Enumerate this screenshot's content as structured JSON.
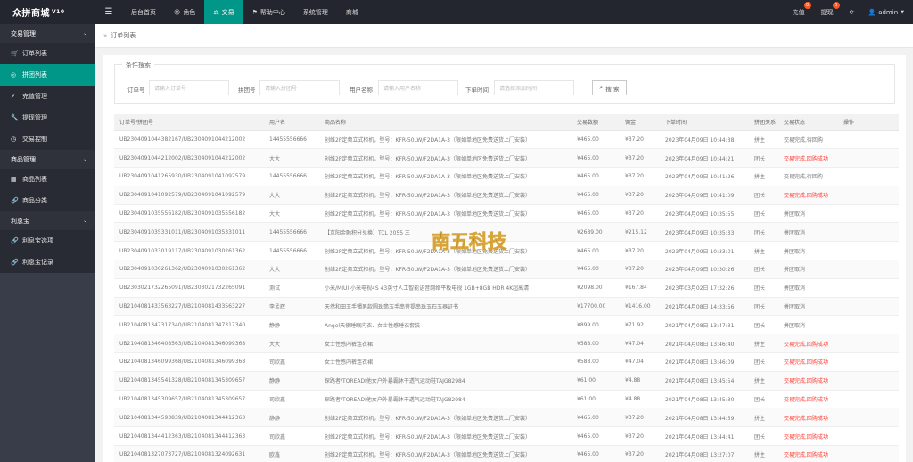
{
  "app": {
    "logo_text": "众拼商城",
    "logo_version": "V10"
  },
  "topnav": {
    "items": [
      {
        "label": "后台首页",
        "icon": ""
      },
      {
        "label": "角色",
        "icon": "user-icon"
      },
      {
        "label": "交易",
        "icon": "scale-icon"
      },
      {
        "label": "帮助中心",
        "icon": "flag-icon"
      },
      {
        "label": "系统管理",
        "icon": ""
      },
      {
        "label": "商城",
        "icon": ""
      }
    ],
    "active_index": 2
  },
  "topright": {
    "recharge_label": "充值",
    "recharge_badge": "0",
    "withdraw_label": "提现",
    "withdraw_badge": "0",
    "user_label": "admin"
  },
  "sidebar": {
    "groups": [
      {
        "label": "交易管理",
        "items": [
          "订单列表",
          "拼团列表",
          "充值管理",
          "提现管理",
          "交易控制"
        ]
      },
      {
        "label": "商品管理",
        "items": [
          "商品列表",
          "商品分类"
        ]
      },
      {
        "label": "利息宝",
        "items": [
          "利息宝选项",
          "利息宝记录"
        ]
      }
    ],
    "active_item": "拼团列表"
  },
  "breadcrumb": {
    "text": "订单列表"
  },
  "search": {
    "legend": "条件搜索",
    "order_label": "订单号",
    "order_placeholder": "请输入订单号",
    "group_label": "拼团号",
    "group_placeholder": "请输入拼团号",
    "user_label": "用户名称",
    "user_placeholder": "请输入用户名称",
    "time_label": "下单时间",
    "time_placeholder": "请选择添加时间",
    "button_label": "搜 索"
  },
  "table": {
    "headers": [
      "订单号/拼团号",
      "用户名",
      "商品名称",
      "交易数额",
      "佣金",
      "下单时间",
      "拼团关系",
      "交易状态",
      "操作"
    ],
    "rows": [
      {
        "order": "UB2304091044382167/UB2304091044212002",
        "user": "14455556666",
        "product": "创维2P定频立式柜机，型号：KFR-50LW/F2DA1A-3（限如单地区免费送货上门安装）",
        "amount": "¥465.00",
        "commission": "¥37.20",
        "time": "2023年04月09日 10:44:38",
        "relation": "拼主",
        "status": "交易完成,待回购",
        "status_red": false
      },
      {
        "order": "UB2304091044212002/UB2304091044212002",
        "user": "大大",
        "product": "创维2P定频立式柜机，型号：KFR-50LW/F2DA1A-3（限如单地区免费送货上门安装）",
        "amount": "¥465.00",
        "commission": "¥37.20",
        "time": "2023年04月09日 10:44:21",
        "relation": "团长",
        "status": "交易完成,回购成功",
        "status_red": true
      },
      {
        "order": "UB2304091041265930/UB2304091041092579",
        "user": "14455556666",
        "product": "创维2P定频立式柜机，型号：KFR-50LW/F2DA1A-3（限如单地区免费送货上门安装）",
        "amount": "¥465.00",
        "commission": "¥37.20",
        "time": "2023年04月09日 10:41:26",
        "relation": "拼主",
        "status": "交易完成,待回购",
        "status_red": false
      },
      {
        "order": "UB2304091041092579/UB2304091041092579",
        "user": "大大",
        "product": "创维2P定频立式柜机，型号：KFR-50LW/F2DA1A-3（限如单地区免费送货上门安装）",
        "amount": "¥465.00",
        "commission": "¥37.20",
        "time": "2023年04月09日 10:41:09",
        "relation": "团长",
        "status": "交易完成,回购成功",
        "status_red": true
      },
      {
        "order": "UB2304091035556182/UB2304091035556182",
        "user": "大大",
        "product": "创维2P定频立式柜机，型号：KFR-50LW/F2DA1A-3（限如单地区免费送货上门安装）",
        "amount": "¥465.00",
        "commission": "¥37.20",
        "time": "2023年04月09日 10:35:55",
        "relation": "团长",
        "status": "拼团取消",
        "status_red": false
      },
      {
        "order": "UB2304091035331011/UB2304091035331011",
        "user": "14455556666",
        "product": "【京阳金融积分兑换】TCL 2055 三",
        "amount": "¥2689.00",
        "commission": "¥215.12",
        "time": "2023年04月09日 10:35:33",
        "relation": "团长",
        "status": "拼团取消",
        "status_red": false
      },
      {
        "order": "UB2304091033019117/UB2304091030261362",
        "user": "14455556666",
        "product": "创维2P定频立式柜机，型号：KFR-50LW/F2DA1A-3（限如单地区免费送货上门安装）",
        "amount": "¥465.00",
        "commission": "¥37.20",
        "time": "2023年04月09日 10:33:01",
        "relation": "拼主",
        "status": "拼团取消",
        "status_red": false
      },
      {
        "order": "UB2304091030261362/UB2304091030261362",
        "user": "大大",
        "product": "创维2P定频立式柜机，型号：KFR-50LW/F2DA1A-3（限如单地区免费送货上门安装）",
        "amount": "¥465.00",
        "commission": "¥37.20",
        "time": "2023年04月09日 10:30:26",
        "relation": "团长",
        "status": "拼团取消",
        "status_red": false
      },
      {
        "order": "UB2303021732265091/UB2303021732265091",
        "user": "测试",
        "product": "小米/MIUI 小米电视4S 43英寸人工智能语音网络平板电视 1GB+8GB HDR 4K超高清",
        "amount": "¥2098.00",
        "commission": "¥167.84",
        "time": "2023年03月02日 17:32:26",
        "relation": "团长",
        "status": "拼团取消",
        "status_red": false
      },
      {
        "order": "UB2104081433563227/UB2104081433563227",
        "user": "李孟辉",
        "product": "天然和田玉手镯男款圆珠翡玉手串菩提串珠玉石玉器证书",
        "amount": "¥17700.00",
        "commission": "¥1416.00",
        "time": "2021年04月08日 14:33:56",
        "relation": "团长",
        "status": "拼团取消",
        "status_red": false
      },
      {
        "order": "UB2104081347317340/UB2104081347317340",
        "user": "静静",
        "product": "Angel天使睡眠内衣、女士性感睡衣套装",
        "amount": "¥899.00",
        "commission": "¥71.92",
        "time": "2021年04月08日 13:47:31",
        "relation": "团长",
        "status": "拼团取消",
        "status_red": false
      },
      {
        "order": "UB2104081346408563/UB2104081346099368",
        "user": "大大",
        "product": "女士性感内裤连衣裙",
        "amount": "¥588.00",
        "commission": "¥47.04",
        "time": "2021年04月08日 13:46:40",
        "relation": "拼主",
        "status": "交易完成,回购成功",
        "status_red": true
      },
      {
        "order": "UB2104081346099368/UB2104081346099368",
        "user": "司欣鑫",
        "product": "女士性感内裤连衣裙",
        "amount": "¥588.00",
        "commission": "¥47.04",
        "time": "2021年04月08日 13:46:09",
        "relation": "团长",
        "status": "交易完成,回购成功",
        "status_red": true
      },
      {
        "order": "UB2104081345541328/UB2104081345309657",
        "user": "静静",
        "product": "探路者/TOREADI他女户外暴霸休干透气运动鞋TAJG82984",
        "amount": "¥61.00",
        "commission": "¥4.88",
        "time": "2021年04月08日 13:45:54",
        "relation": "拼主",
        "status": "交易完成,回购成功",
        "status_red": true
      },
      {
        "order": "UB2104081345309657/UB2104081345309657",
        "user": "司欣鑫",
        "product": "探路者/TOREADI他女户外暴霸休干透气运动鞋TAJG82984",
        "amount": "¥61.00",
        "commission": "¥4.88",
        "time": "2021年04月08日 13:45:30",
        "relation": "团长",
        "status": "交易完成,回购成功",
        "status_red": true
      },
      {
        "order": "UB2104081344593839/UB2104081344412363",
        "user": "静静",
        "product": "创维2P定频立式柜机，型号：KFR-50LW/F2DA1A-3（限如单地区免费送货上门安装）",
        "amount": "¥465.00",
        "commission": "¥37.20",
        "time": "2021年04月08日 13:44:59",
        "relation": "拼主",
        "status": "交易完成,回购成功",
        "status_red": true
      },
      {
        "order": "UB2104081344412363/UB2104081344412363",
        "user": "司欣鑫",
        "product": "创维2P定频立式柜机，型号：KFR-50LW/F2DA1A-3（限如单地区免费送货上门安装）",
        "amount": "¥465.00",
        "commission": "¥37.20",
        "time": "2021年04月08日 13:44:41",
        "relation": "团长",
        "status": "交易完成,回购成功",
        "status_red": true
      },
      {
        "order": "UB2104081327073727/UB2104081324092631",
        "user": "欧鑫",
        "product": "创维2P定频立式柜机，型号：KFR-50LW/F2DA1A-3（限如单地区免费送货上门安装）",
        "amount": "¥465.00",
        "commission": "¥37.20",
        "time": "2021年04月08日 13:27:07",
        "relation": "拼主",
        "status": "交易完成,回购成功",
        "status_red": true
      }
    ]
  },
  "watermark": {
    "text": "南五科技"
  }
}
